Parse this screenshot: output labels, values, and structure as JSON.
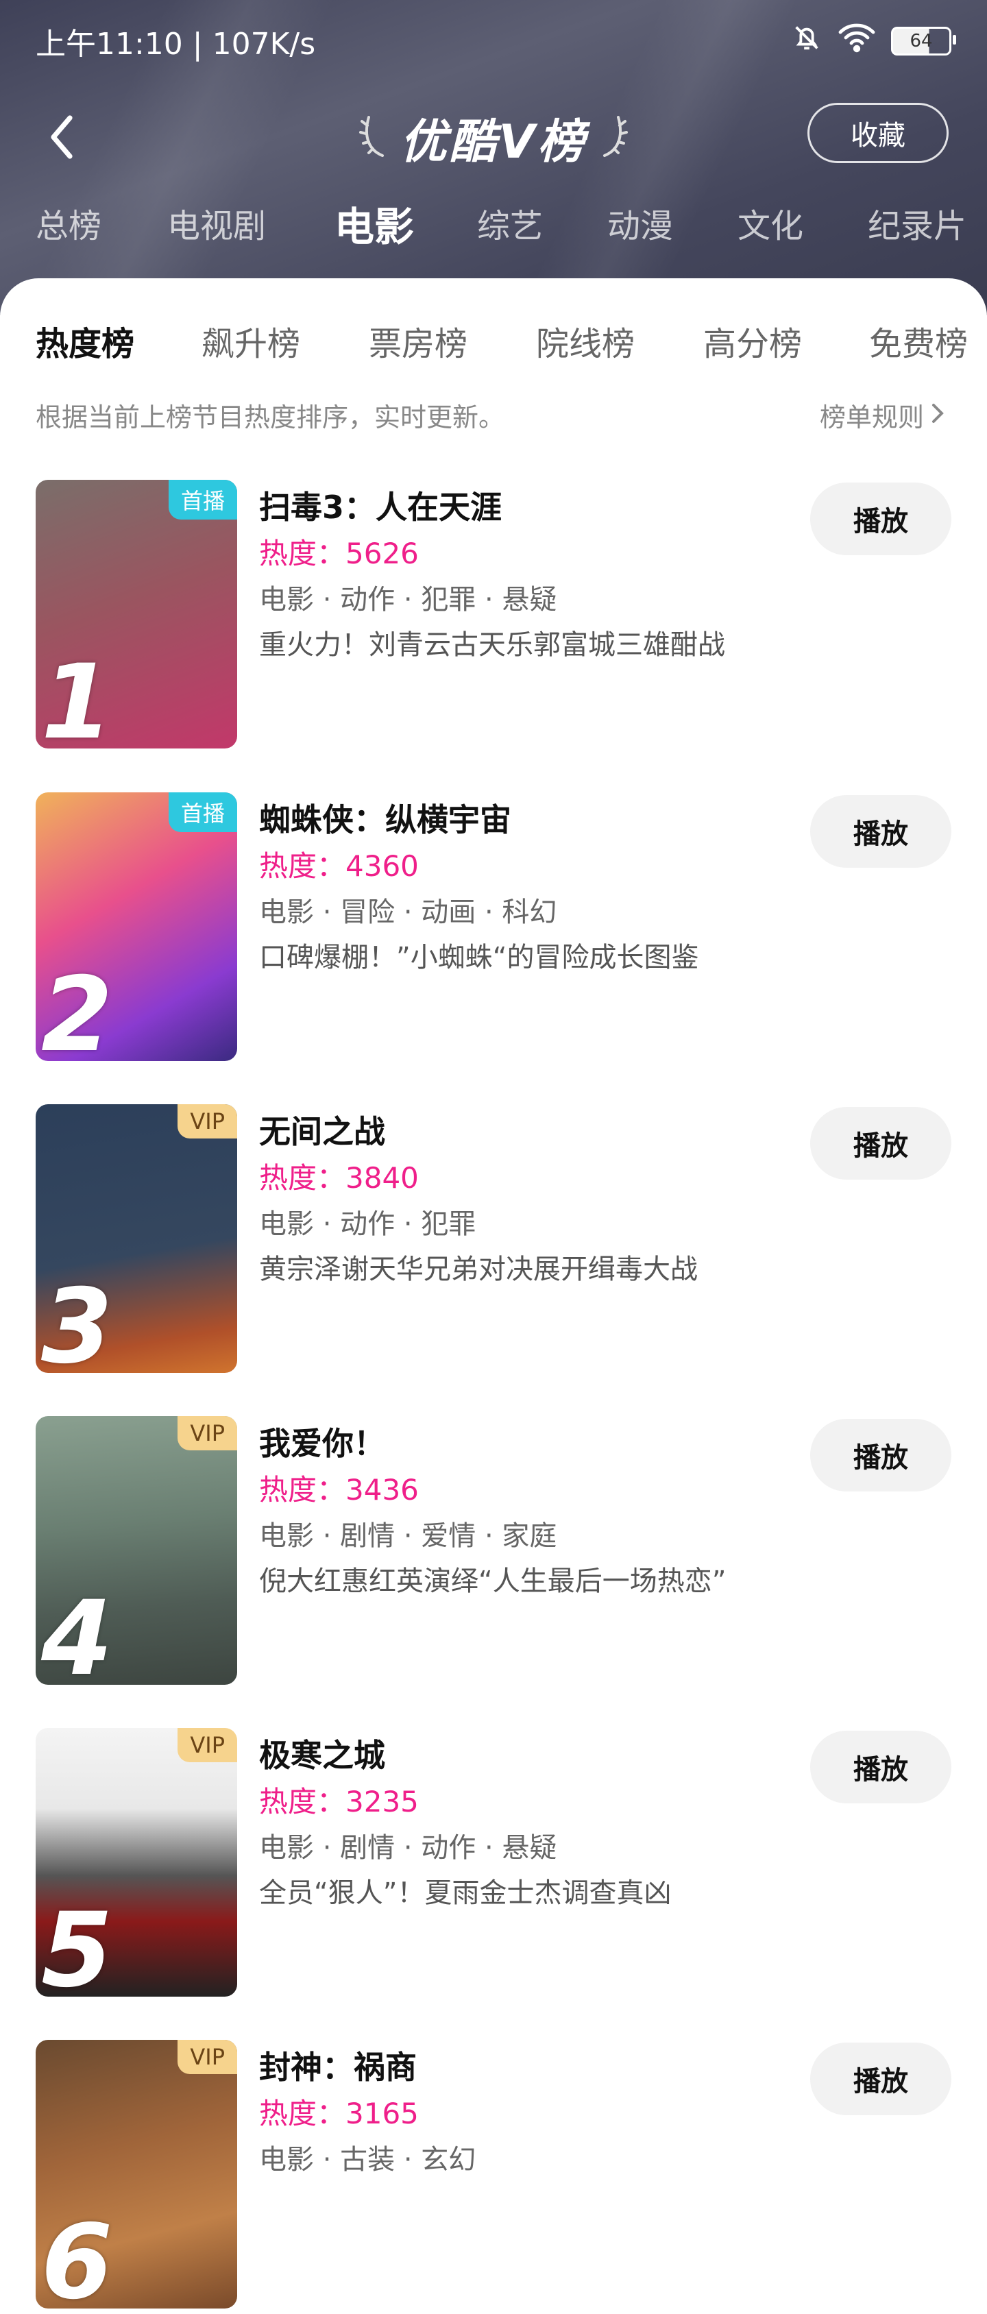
{
  "status_bar": {
    "time": "上午11:10 | 107K/s",
    "battery": "64"
  },
  "header": {
    "title": "优酷V榜",
    "favorite_label": "收藏",
    "categories": [
      "总榜",
      "电视剧",
      "电影",
      "综艺",
      "动漫",
      "文化",
      "纪录片"
    ],
    "active_category": "电影"
  },
  "sub_tabs": [
    "热度榜",
    "飙升榜",
    "票房榜",
    "院线榜",
    "高分榜",
    "免费榜"
  ],
  "active_sub_tab": "热度榜",
  "description": "根据当前上榜节目热度排序，实时更新。",
  "rules_label": "榜单规则",
  "play_label": "播放",
  "items": [
    {
      "rank": "1",
      "badge": "首播",
      "title": "扫毒3：人在天涯",
      "heat": "热度：5626",
      "genre": "电影 · 动作 · 犯罪 · 悬疑",
      "tagline": "重火力！刘青云古天乐郭富城三雄酣战"
    },
    {
      "rank": "2",
      "badge": "首播",
      "title": "蜘蛛侠：纵横宇宙",
      "heat": "热度：4360",
      "genre": "电影 · 冒险 · 动画 · 科幻",
      "tagline": "口碑爆棚！”小蜘蛛“的冒险成长图鉴"
    },
    {
      "rank": "3",
      "badge": "VIP",
      "title": "无间之战",
      "heat": "热度：3840",
      "genre": "电影 · 动作 · 犯罪",
      "tagline": "黄宗泽谢天华兄弟对决展开缉毒大战"
    },
    {
      "rank": "4",
      "badge": "VIP",
      "title": "我爱你！",
      "heat": "热度：3436",
      "genre": "电影 · 剧情 · 爱情 · 家庭",
      "tagline": "倪大红惠红英演绎“人生最后一场热恋”"
    },
    {
      "rank": "5",
      "badge": "VIP",
      "title": "极寒之城",
      "heat": "热度：3235",
      "genre": "电影 · 剧情 · 动作 · 悬疑",
      "tagline": "全员“狠人”！夏雨金士杰调查真凶"
    },
    {
      "rank": "6",
      "badge": "VIP",
      "title": "封神：祸商",
      "heat": "热度：3165",
      "genre": "电影 · 古装 · 玄幻",
      "tagline": ""
    }
  ]
}
